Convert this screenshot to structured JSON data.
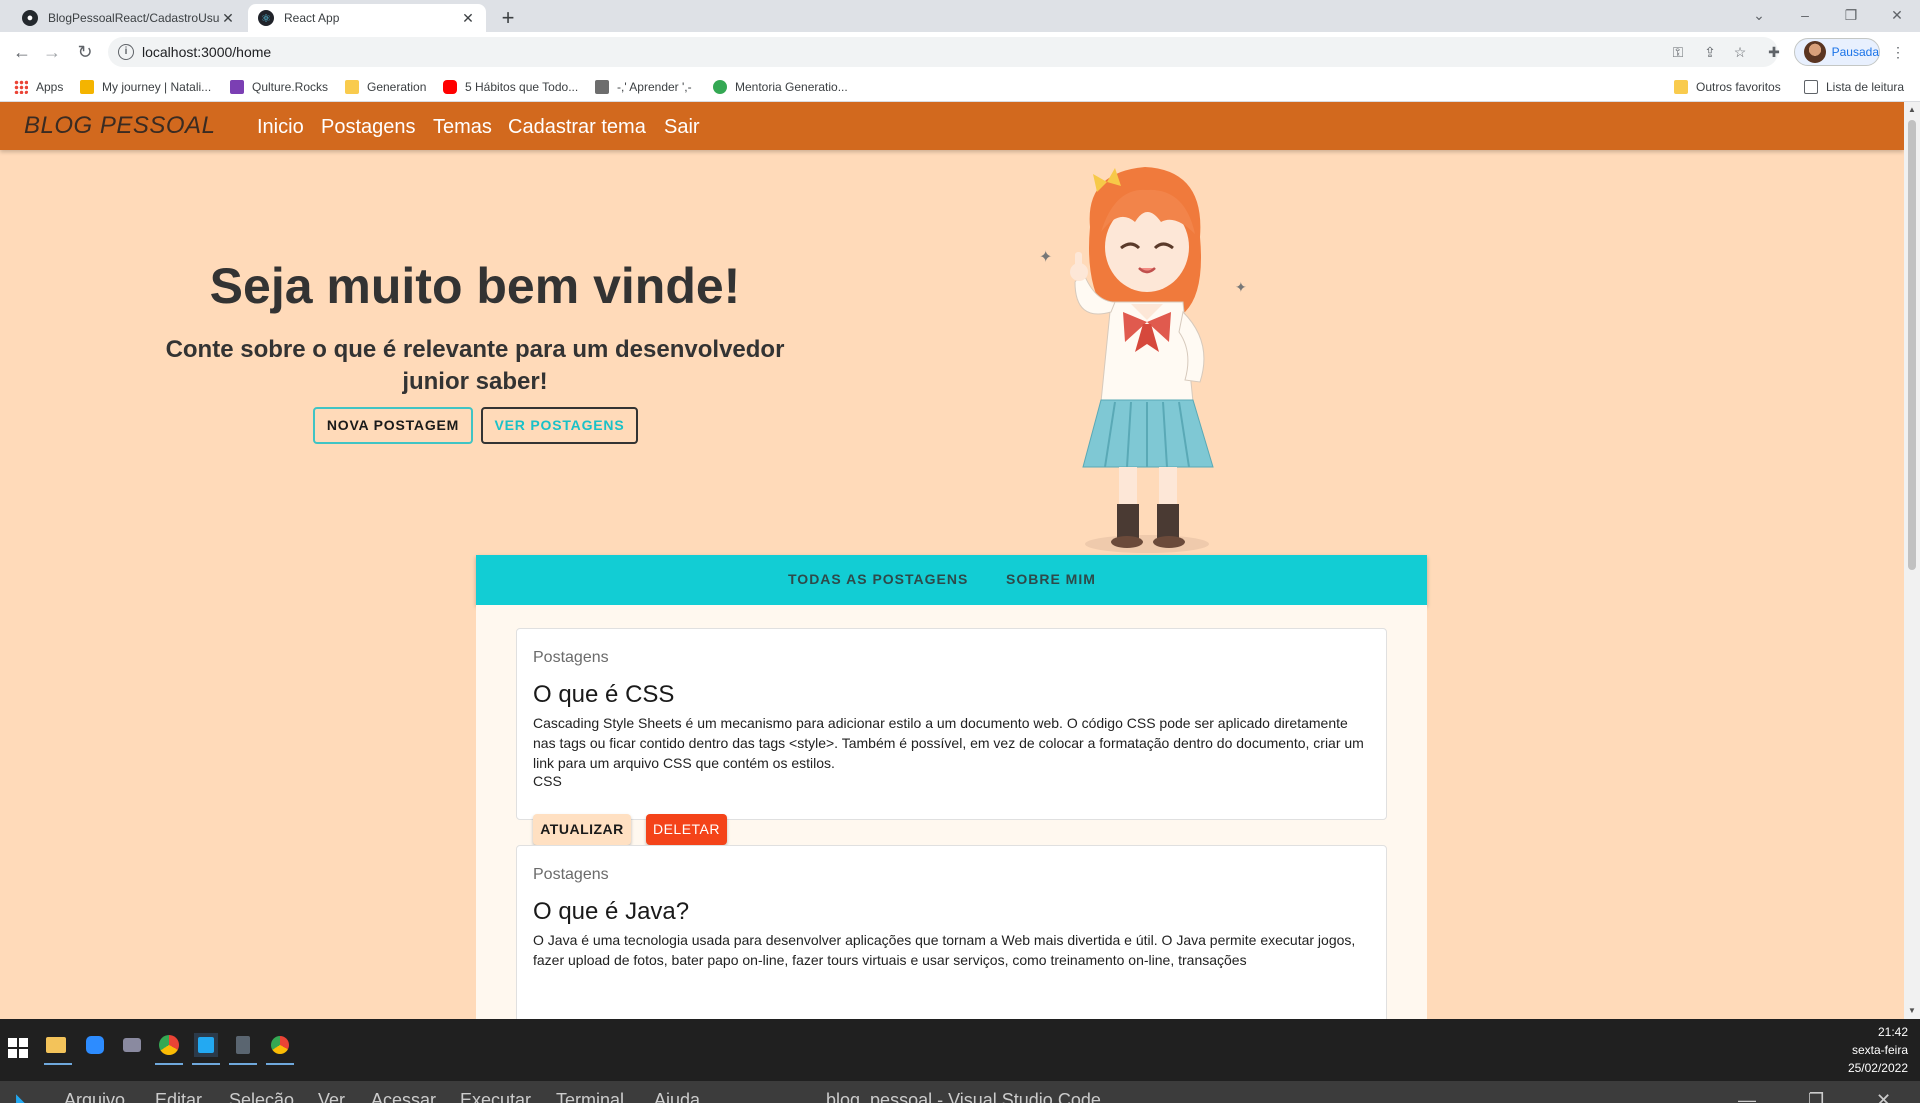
{
  "browser": {
    "tabs": [
      {
        "title": "BlogPessoalReact/CadastroUsuario",
        "icon": "github-icon"
      },
      {
        "title": "React App",
        "icon": "react-icon"
      }
    ],
    "new_tab_label": "+",
    "url": "localhost:3000/home",
    "profile_label": "Pausada",
    "bookmarks": [
      "Apps",
      "My journey | Natali...",
      "Qulture.Rocks",
      "Generation",
      "5 Hábitos que Todo...",
      "-,' Aprender ',-",
      "Mentoria Generatio...",
      "Outros favoritos",
      "Lista de leitura"
    ]
  },
  "app": {
    "brand": "BLOG PESSOAL",
    "menu": [
      "Inicio",
      "Postagens",
      "Temas",
      "Cadastrar tema",
      "Sair"
    ],
    "hero": {
      "title": "Seja muito bem vinde!",
      "subtitle": "Conte sobre o que é relevante para um desenvolvedor junior saber!",
      "new_post_button": "NOVA POSTAGEM",
      "view_posts_button": "VER POSTAGENS"
    },
    "tabs": [
      "TODAS AS POSTAGENS",
      "SOBRE MIM"
    ],
    "posts": [
      {
        "category": "Postagens",
        "title": "O que é CSS",
        "text": "Cascading Style Sheets é um mecanismo para adicionar estilo a um documento web. O código CSS pode ser aplicado diretamente nas tags ou ficar contido dentro das tags <style>. Também é possível, em vez de colocar a formatação dentro do documento, criar um link para um arquivo CSS que contém os estilos.",
        "theme": "CSS",
        "update_button": "ATUALIZAR",
        "delete_button": "DELETAR"
      },
      {
        "category": "Postagens",
        "title": "O que é Java?",
        "text": "O Java é uma tecnologia usada para desenvolver aplicações que tornam a Web mais divertida e útil. O Java permite executar jogos, fazer upload de fotos, bater papo on-line, fazer tours virtuais e usar serviços, como treinamento on-line, transações"
      }
    ]
  },
  "taskbar": {
    "time": "21:42",
    "weekday": "sexta-feira",
    "date": "25/02/2022"
  },
  "vscode": {
    "menu": [
      "Arquivo",
      "Editar",
      "Seleção",
      "Ver",
      "Acessar",
      "Executar",
      "Terminal",
      "Ajuda"
    ],
    "title": "blog_pessoal - Visual Studio Code"
  },
  "colors": {
    "appbar": "#d2691e",
    "page_bg": "#ffdab9",
    "tabs_bar": "#12cdd4",
    "delete": "#f44319"
  }
}
